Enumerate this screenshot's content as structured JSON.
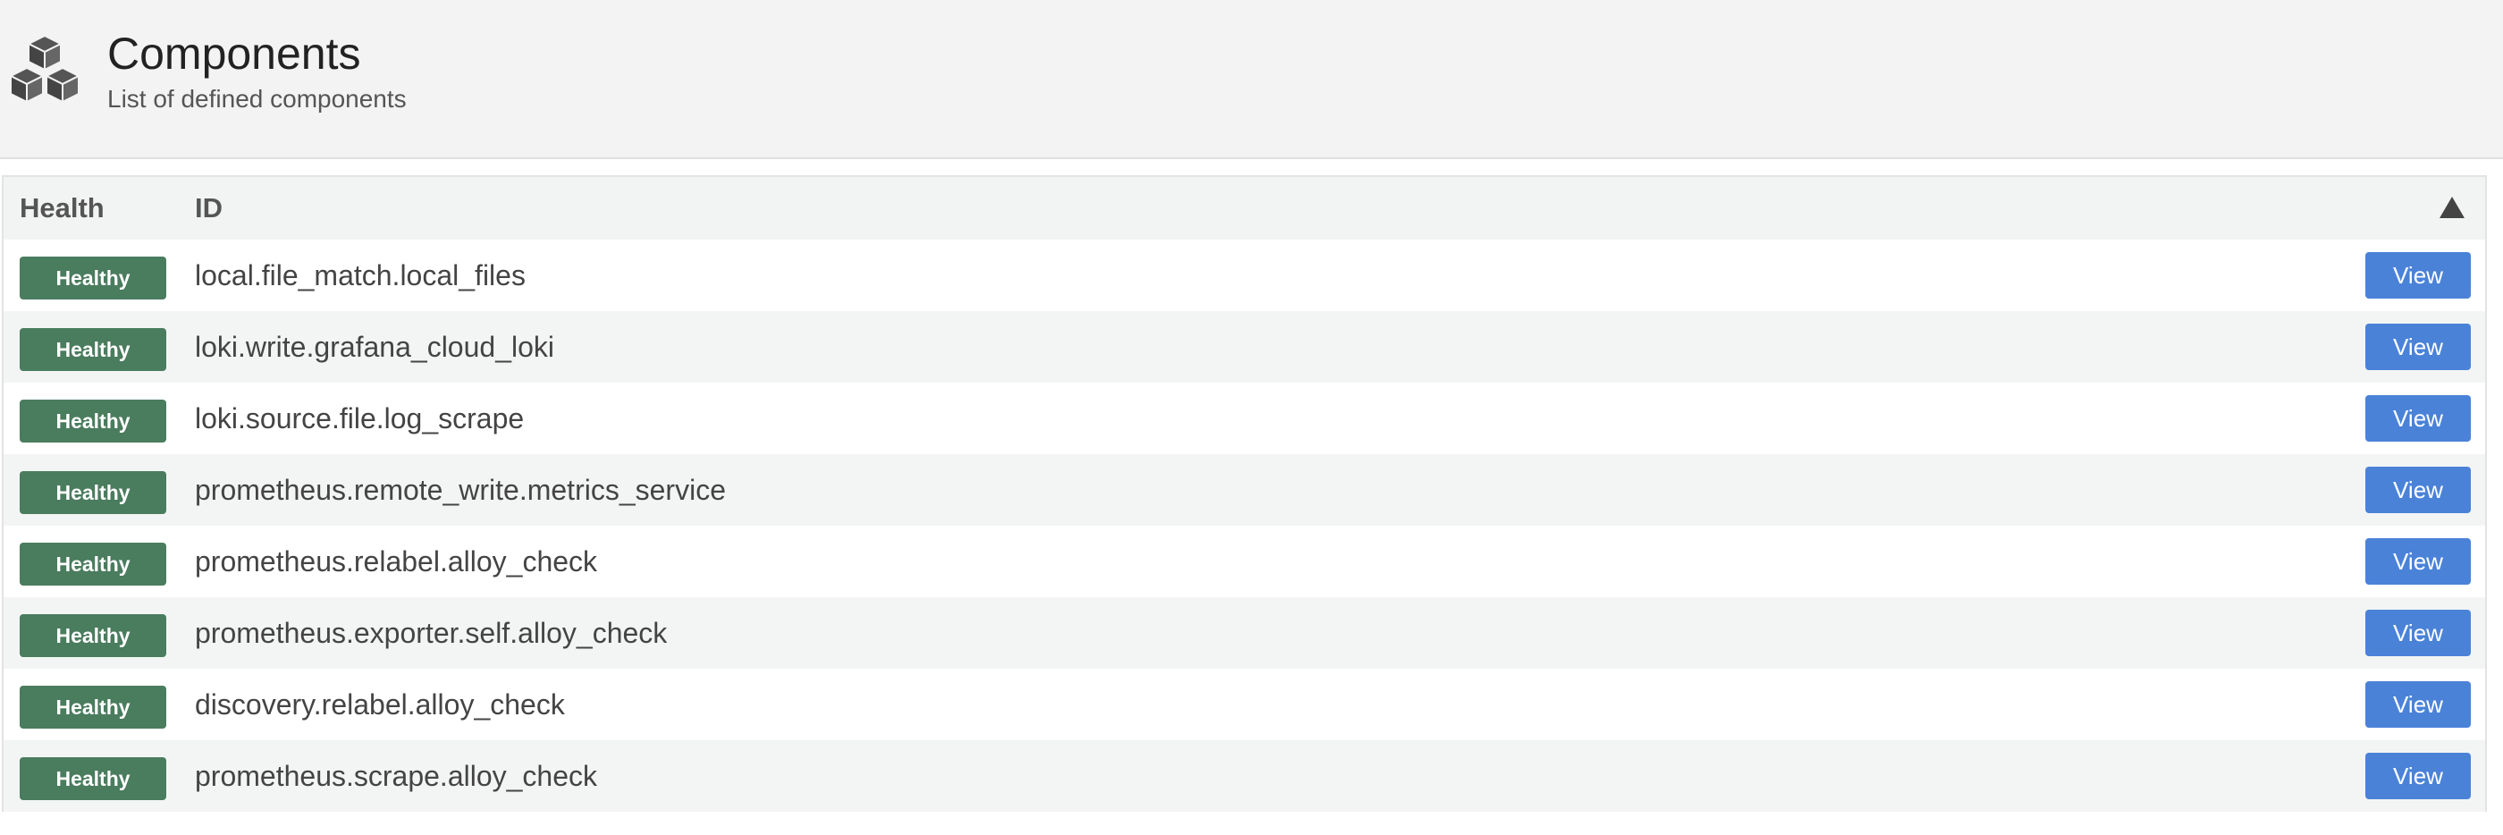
{
  "header": {
    "icon": "cubes-icon",
    "title": "Components",
    "subtitle": "List of defined components"
  },
  "table": {
    "columns": {
      "health": "Health",
      "id": "ID"
    },
    "sort_icon": "sort-ascending-triangle-icon",
    "rows": [
      {
        "health": "Healthy",
        "id": "local.file_match.local_files",
        "action": "View"
      },
      {
        "health": "Healthy",
        "id": "loki.write.grafana_cloud_loki",
        "action": "View"
      },
      {
        "health": "Healthy",
        "id": "loki.source.file.log_scrape",
        "action": "View"
      },
      {
        "health": "Healthy",
        "id": "prometheus.remote_write.metrics_service",
        "action": "View"
      },
      {
        "health": "Healthy",
        "id": "prometheus.relabel.alloy_check",
        "action": "View"
      },
      {
        "health": "Healthy",
        "id": "prometheus.exporter.self.alloy_check",
        "action": "View"
      },
      {
        "health": "Healthy",
        "id": "discovery.relabel.alloy_check",
        "action": "View"
      },
      {
        "health": "Healthy",
        "id": "prometheus.scrape.alloy_check",
        "action": "View"
      }
    ]
  },
  "colors": {
    "healthy_badge": "#4a7c5e",
    "view_button": "#4a82d8",
    "header_bg": "#f3f3f3"
  }
}
